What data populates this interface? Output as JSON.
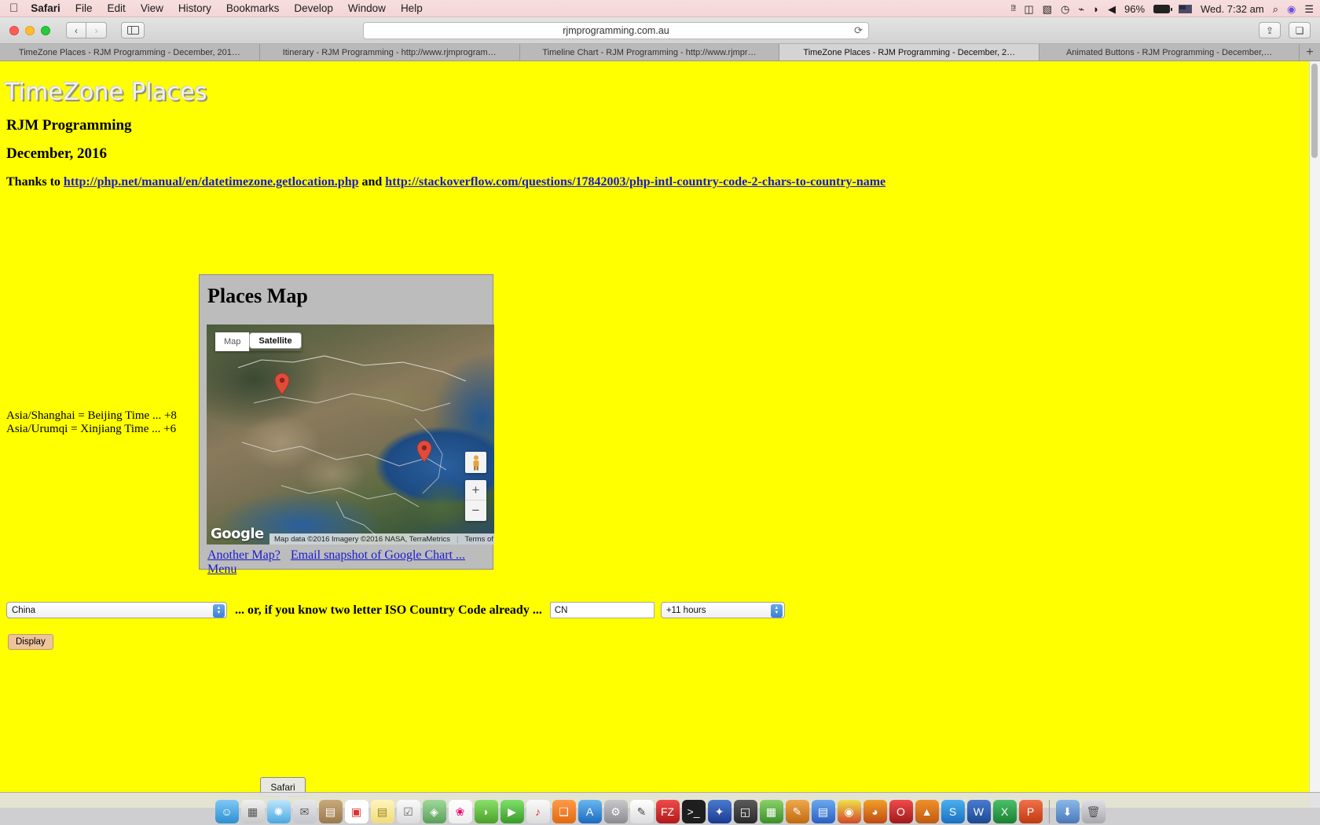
{
  "menubar": {
    "apple_icon": "apple-logo",
    "items": [
      {
        "label": "Safari",
        "bold": true
      },
      {
        "label": "File",
        "bold": false
      },
      {
        "label": "Edit",
        "bold": false
      },
      {
        "label": "View",
        "bold": false
      },
      {
        "label": "History",
        "bold": false
      },
      {
        "label": "Bookmarks",
        "bold": false
      },
      {
        "label": "Develop",
        "bold": false
      },
      {
        "label": "Window",
        "bold": false
      },
      {
        "label": "Help",
        "bold": false
      }
    ],
    "status": {
      "battery_percent": "96%",
      "datetime": "Wed. 7:32 am",
      "icons": [
        "signal-bars-icon",
        "airplay-icon",
        "dropbox-icon",
        "timemachine-icon",
        "bluetooth-icon",
        "wifi-icon",
        "volume-icon",
        "battery-icon",
        "flag-au-icon",
        "spotlight-search-icon",
        "siri-icon",
        "notification-center-icon"
      ]
    }
  },
  "browser": {
    "url": "rjmprogramming.com.au",
    "back_icon": "chevron-left-icon",
    "forward_icon": "chevron-right-icon",
    "sidebar_icon": "sidebar-icon",
    "reload_icon": "reload-icon",
    "share_icon": "share-icon",
    "tabs_overview_icon": "tabs-overview-icon",
    "new_tab_label": "+",
    "tabs": [
      {
        "label": "TimeZone Places - RJM Programming - December, 201…",
        "active": false
      },
      {
        "label": "Itinerary - RJM Programming - http://www.rjmprogram…",
        "active": false
      },
      {
        "label": "Timeline Chart - RJM Programming - http://www.rjmpr…",
        "active": false
      },
      {
        "label": "TimeZone Places - RJM Programming - December, 2…",
        "active": true
      },
      {
        "label": "Animated Buttons - RJM Programming - December,…",
        "active": false
      }
    ]
  },
  "page": {
    "background_color": "#ffff00",
    "title": "TimeZone Places",
    "subtitle": "RJM Programming",
    "date": "December, 2016",
    "thanks": {
      "prefix": "Thanks to ",
      "link1": "http://php.net/manual/en/datetimezone.getlocation.php",
      "middle": " and ",
      "link2": "http://stackoverflow.com/questions/17842003/php-intl-country-code-2-chars-to-country-name"
    },
    "timezones": [
      "Asia/Shanghai = Beijing Time ... +8",
      "Asia/Urumqi = Xinjiang Time ... +6"
    ],
    "map_panel": {
      "heading": "Places Map",
      "maptype": {
        "map_label": "Map",
        "satellite_label": "Satellite",
        "selected": "Satellite"
      },
      "pegman_icon": "street-view-pegman-icon",
      "zoom_in_label": "+",
      "zoom_out_label": "−",
      "google_wordmark": "Google",
      "attribution": "Map data ©2016 Imagery ©2016 NASA, TerraMetrics",
      "terms_label": "Terms of Use",
      "markers": [
        {
          "name": "urumqi-marker",
          "color": "#e04b3c"
        },
        {
          "name": "shanghai-marker",
          "color": "#e04b3c"
        }
      ],
      "links": [
        {
          "label": "Another Map?",
          "name": "another-map-link"
        },
        {
          "label": "Email snapshot of Google Chart ...",
          "name": "email-snapshot-link"
        },
        {
          "label": "Menu",
          "name": "menu-link"
        }
      ]
    },
    "form": {
      "country_selected": "China",
      "hint": "... or, if you know two letter ISO Country Code already ...",
      "iso_value": "CN",
      "iso_placeholder": "",
      "hours_selected": "+11 hours",
      "display_button": "Display"
    }
  },
  "tooltip": {
    "label": "Safari"
  },
  "dock": {
    "items": [
      "finder-icon",
      "launchpad-icon",
      "safari-icon",
      "mail-icon",
      "contacts-icon",
      "calendar-icon",
      "notes-icon",
      "reminders-icon",
      "maps-icon",
      "photos-icon",
      "messages-icon",
      "facetime-icon",
      "itunes-icon",
      "ibooks-icon",
      "appstore-icon",
      "preferences-icon",
      "textedit-icon",
      "filezilla-icon",
      "terminal-icon",
      "xcode-icon",
      "dashboard-icon",
      "numbers-icon",
      "pages-icon",
      "keynote-icon",
      "chrome-icon",
      "firefox-icon",
      "opera-icon",
      "vlc-icon",
      "skype-icon",
      "word-icon",
      "excel-icon",
      "powerpoint-icon",
      "downloads-icon",
      "trash-icon"
    ]
  }
}
